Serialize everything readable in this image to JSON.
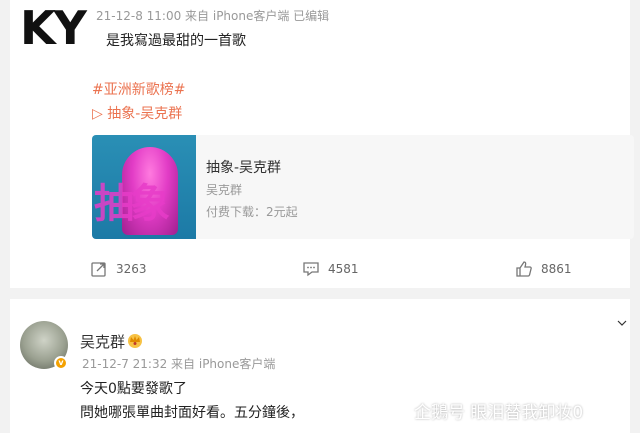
{
  "logo": {
    "text": "KY"
  },
  "post1": {
    "meta": "21-12-8 11:00 来自 iPhone客户端 已编辑",
    "text": "是我寫過最甜的一首歌",
    "topic": "#亚洲新歌榜#",
    "song_link": "▷ 抽象-吴克群",
    "music_card": {
      "title": "抽象-吴克群",
      "artist": "吴克群",
      "price": "付费下载：2元起",
      "cover_text": "抽象"
    },
    "actions": {
      "share_count": "3263",
      "comment_count": "4581",
      "like_count": "8861"
    }
  },
  "post2": {
    "username": "吴克群",
    "meta": "21-12-7 21:32 来自 iPhone客户端",
    "line1": "今天0點要發歌了",
    "line2": "問她哪張單曲封面好看。五分鐘後，",
    "badge": "v"
  },
  "watermark": {
    "text": "企鵝号 眼泪替我卸妆0"
  },
  "colors": {
    "accent": "#eb7350",
    "meta_gray": "#999999",
    "vip_gold": "#f4a100"
  },
  "icons": {
    "share": "share-icon",
    "comment": "comment-icon",
    "like": "thumbs-up-icon",
    "crown": "crown-icon",
    "more": "chevron-down-icon"
  }
}
